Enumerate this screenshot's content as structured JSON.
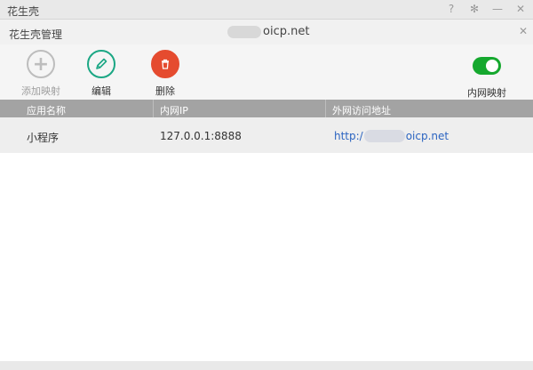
{
  "window": {
    "title": "花生壳",
    "controls": {
      "help": "?",
      "settings": "✻",
      "minimize": "—",
      "close": "✕"
    }
  },
  "dialog": {
    "title": "花生壳管理",
    "domain_suffix": "oicp.net",
    "close": "✕"
  },
  "toolbar": {
    "add_label": "添加映射",
    "edit_label": "编辑",
    "delete_label": "删除",
    "toggle_label": "内网映射",
    "toggle_on": true
  },
  "table": {
    "columns": [
      "应用名称",
      "内网IP",
      "外网访问地址"
    ],
    "rows": [
      {
        "name": "小程序",
        "ip": "127.0.0.1:8888",
        "url_prefix": "http:/",
        "url_suffix": "oicp.net"
      }
    ]
  },
  "colors": {
    "edit": "#1ba784",
    "delete": "#e54b2f",
    "toggle": "#15a82e",
    "link": "#2b64c1"
  }
}
